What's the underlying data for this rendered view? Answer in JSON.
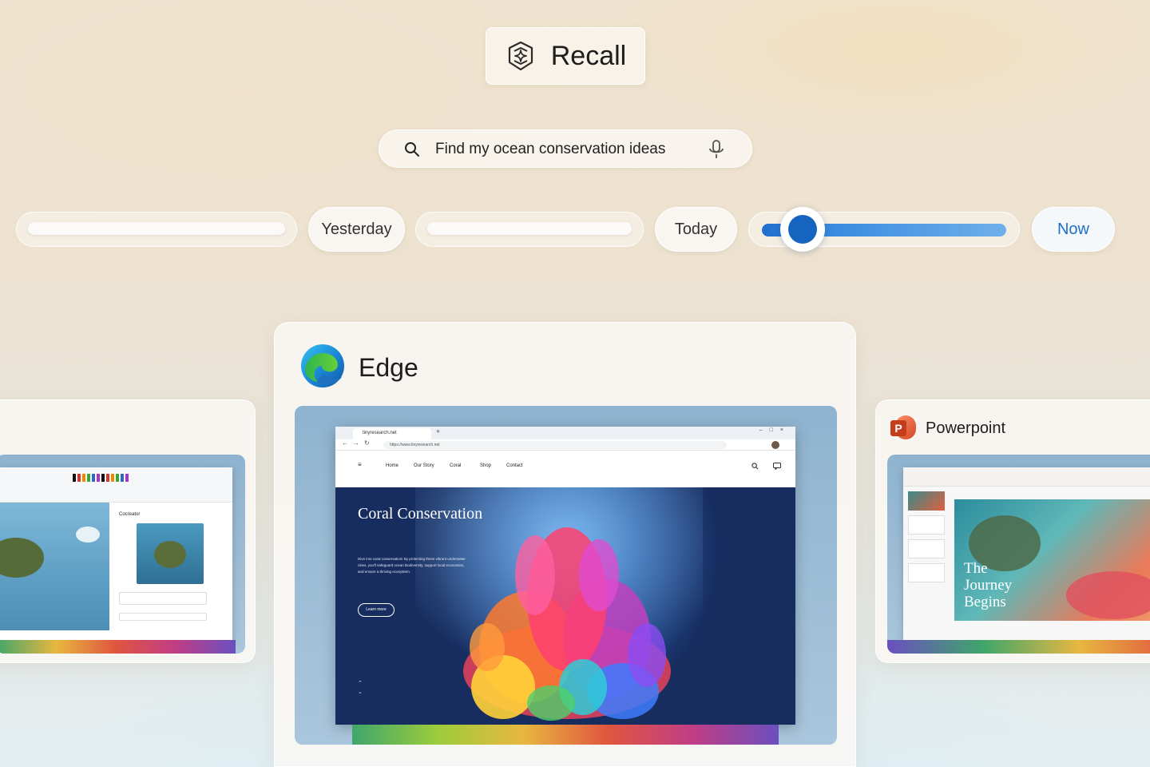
{
  "app": {
    "title": "Recall"
  },
  "search": {
    "query": "Find my ocean conservation ideas"
  },
  "timeline": {
    "labels": [
      "Yesterday",
      "Today",
      "Now"
    ],
    "position": 0.17
  },
  "cards": {
    "main": {
      "app_name": "Edge",
      "tab_title": "tinyresearch.net",
      "url": "https://www.tinyresearch.net",
      "nav": [
        "Home",
        "Our Story",
        "Coral",
        "Shop",
        "Contact"
      ],
      "hero_title": "Coral Conservation",
      "hero_body": "Dive into coral conservation! By protecting these vibrant underwater cities, you'll safeguard ocean biodiversity, support local economies, and ensure a thriving ecosystem.",
      "hero_button": "Learn more"
    },
    "right": {
      "app_name": "Powerpoint",
      "slide_title": "The Journey Begins"
    },
    "left": {
      "panel_title": "Cocreator"
    }
  },
  "colors": {
    "accent": "#1565c0",
    "now_label": "#1f6fc4",
    "powerpoint": "#d24726"
  }
}
